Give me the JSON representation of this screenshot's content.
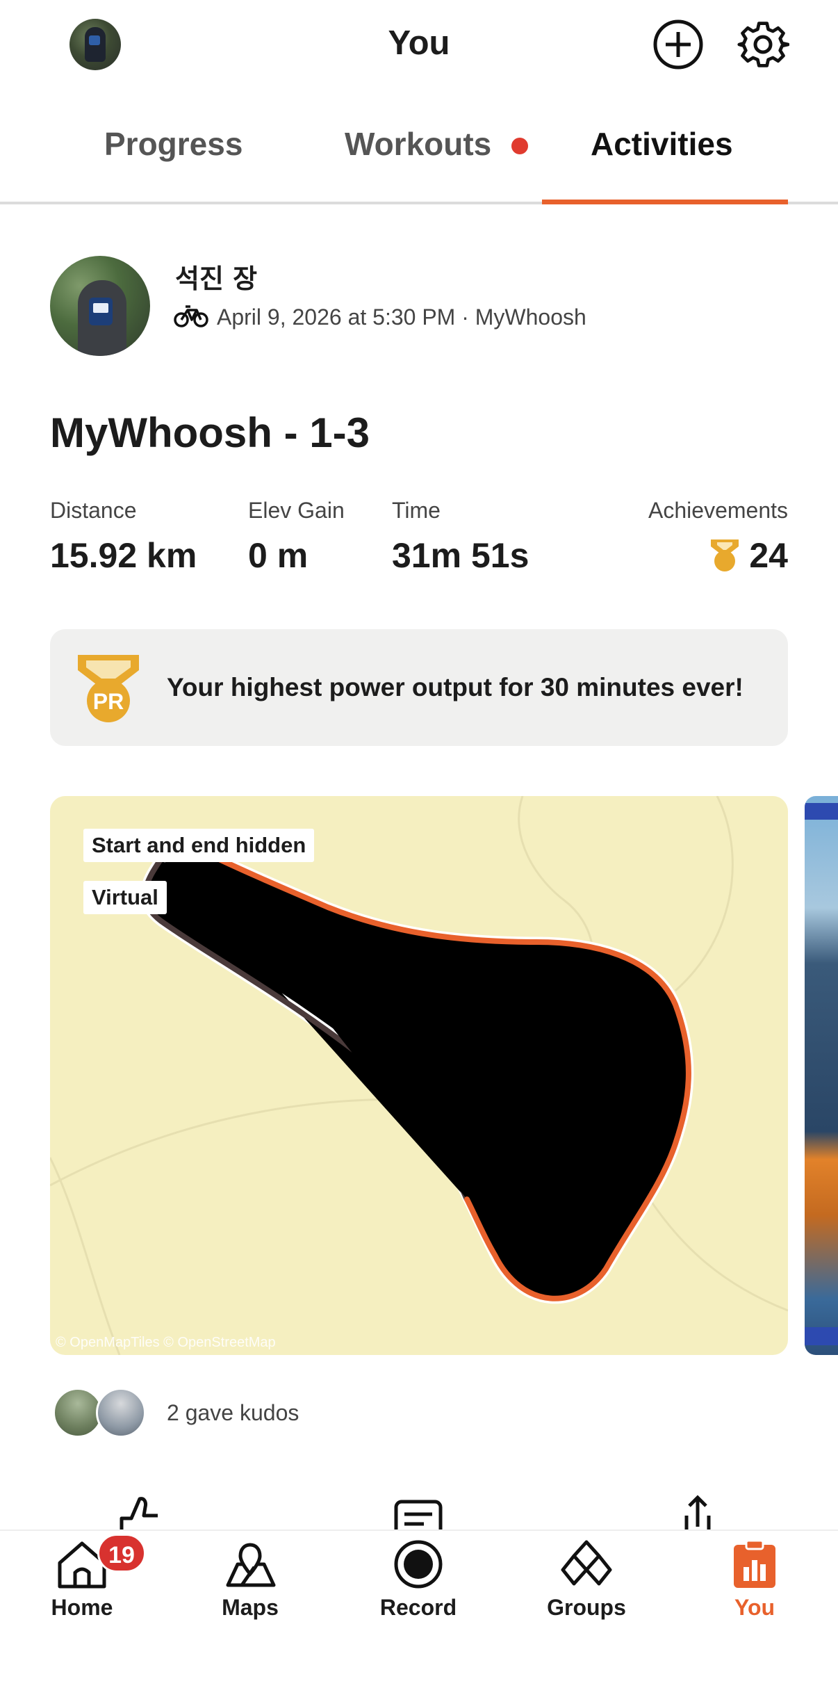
{
  "header": {
    "title": "You"
  },
  "tabs": [
    {
      "label": "Progress"
    },
    {
      "label": "Workouts"
    },
    {
      "label": "Activities"
    }
  ],
  "activity": {
    "athlete_name": "석진 장",
    "meta": "April 9, 2026 at 5:30 PM · MyWhoosh",
    "title": "MyWhoosh - 1-3",
    "stats": [
      {
        "label": "Distance",
        "value": "15.92 km"
      },
      {
        "label": "Elev Gain",
        "value": "0 m"
      },
      {
        "label": "Time",
        "value": "31m 51s"
      },
      {
        "label": "Achievements",
        "value": "24"
      }
    ],
    "pr_badge_text": "PR",
    "pr_message": "Your highest power output for 30 minutes ever!",
    "map": {
      "tags": [
        "Start and end hidden",
        "Virtual"
      ],
      "attribution": "© OpenMapTiles © OpenStreetMap"
    },
    "kudos_text": "2 gave kudos"
  },
  "nav": {
    "items": [
      {
        "label": "Home"
      },
      {
        "label": "Maps"
      },
      {
        "label": "Record"
      },
      {
        "label": "Groups"
      },
      {
        "label": "You"
      }
    ],
    "home_badge": "19"
  },
  "colors": {
    "accent": "#e8612c",
    "badge": "#d8322f",
    "map_bg": "#f5efc0",
    "route": "#e8612c",
    "route_dark": "#4a3a3a"
  }
}
